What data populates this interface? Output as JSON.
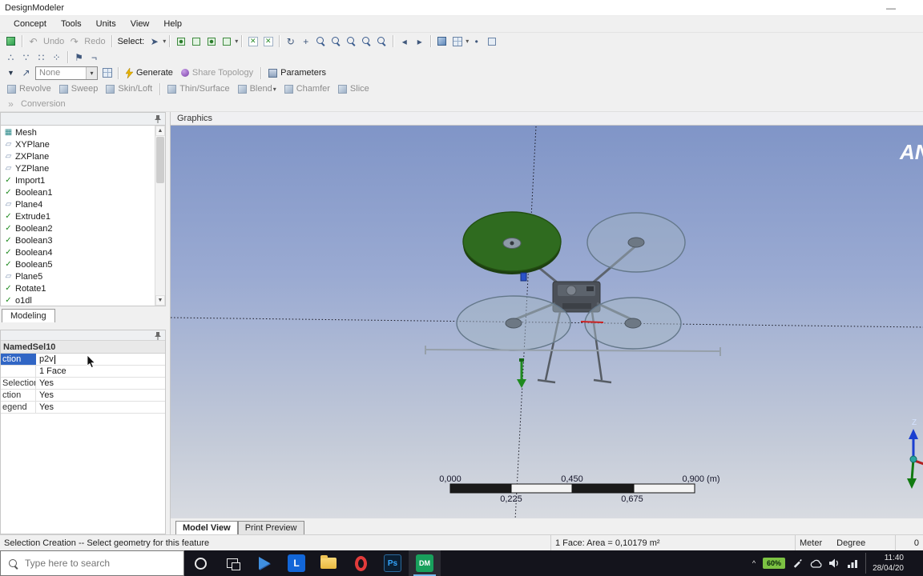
{
  "icons": {
    "undo": "↶",
    "redo": "↷",
    "mesh": "▦",
    "plane": "▱",
    "check": "✓",
    "flag": "⚑",
    "pt1": "∴",
    "pt2": "∵",
    "pt3": "∷",
    "pt4": "⁘",
    "neg": "¬",
    "cursor": "➤",
    "rotate": "↻",
    "pan": "+",
    "prev": "◂",
    "next": "▸",
    "dot": "•",
    "tri": "▼",
    "arrow_ne": "↗",
    "chevrons": "»"
  },
  "titlebar": {
    "title": "DesignModeler"
  },
  "menubar": {
    "items": [
      "Concept",
      "Tools",
      "Units",
      "View",
      "Help"
    ]
  },
  "toolbar": {
    "undo_label": "Undo",
    "redo_label": "Redo",
    "select_label": "Select:",
    "mode_dropdown_value": "None",
    "generate_label": "Generate",
    "share_topology_label": "Share Topology",
    "parameters_label": "Parameters",
    "features": [
      "Revolve",
      "Sweep",
      "Skin/Loft",
      "Thin/Surface",
      "Blend",
      "Chamfer",
      "Slice"
    ],
    "conversion_label": "Conversion"
  },
  "tree": {
    "items": [
      {
        "label": "Mesh"
      },
      {
        "label": "XYPlane"
      },
      {
        "label": "ZXPlane"
      },
      {
        "label": "YZPlane"
      },
      {
        "label": "Import1"
      },
      {
        "label": "Boolean1"
      },
      {
        "label": "Plane4"
      },
      {
        "label": "Extrude1"
      },
      {
        "label": "Boolean2"
      },
      {
        "label": "Boolean3"
      },
      {
        "label": "Boolean4"
      },
      {
        "label": "Boolean5"
      },
      {
        "label": "Plane5"
      },
      {
        "label": "Rotate1"
      },
      {
        "label": "o1dl"
      }
    ],
    "tab_label": "Modeling"
  },
  "details": {
    "group_header": "NamedSel10",
    "rows": [
      {
        "label": "ction",
        "value": "p2v"
      },
      {
        "label": "",
        "value": "1 Face"
      },
      {
        "label": "Selection",
        "value": "Yes"
      },
      {
        "label": "ction",
        "value": "Yes"
      },
      {
        "label": "egend",
        "value": "Yes"
      }
    ]
  },
  "graphics": {
    "panel_title": "Graphics",
    "watermark": "AN",
    "ruler": {
      "top_labels": [
        "0,000",
        "0,450",
        "0,900 (m)"
      ],
      "bottom_labels": [
        "0,225",
        "0,675"
      ]
    },
    "triad_z_label": "Z",
    "view_tabs": [
      {
        "label": "Model View"
      },
      {
        "label": "Print Preview"
      }
    ]
  },
  "statusbar": {
    "message": "Selection Creation -- Select geometry for this feature",
    "selection_info": "1 Face: Area = 0,10179 m²",
    "length_unit": "Meter",
    "angle_unit": "Degree",
    "counter": "0"
  },
  "taskbar": {
    "search_placeholder": "Type here to search",
    "battery_percent": "60%",
    "clock_time": "11:40",
    "clock_date": "28/04/20",
    "apps": [
      {
        "name": "cortana",
        "label": ""
      },
      {
        "name": "task-view",
        "label": ""
      },
      {
        "name": "media-app",
        "label": ""
      },
      {
        "name": "labview",
        "label": "L"
      },
      {
        "name": "file-explorer",
        "label": ""
      },
      {
        "name": "opera",
        "label": ""
      },
      {
        "name": "photoshop",
        "label": "Ps"
      },
      {
        "name": "designmodeler",
        "label": "DM"
      }
    ]
  },
  "colors": {
    "selection_blue": "#3166c5",
    "battery_green": "#7cc243",
    "selected_face_green": "#2f6b1f",
    "viewport_gradient_top": "#8095c7",
    "viewport_gradient_bottom": "#d8dbe1"
  }
}
